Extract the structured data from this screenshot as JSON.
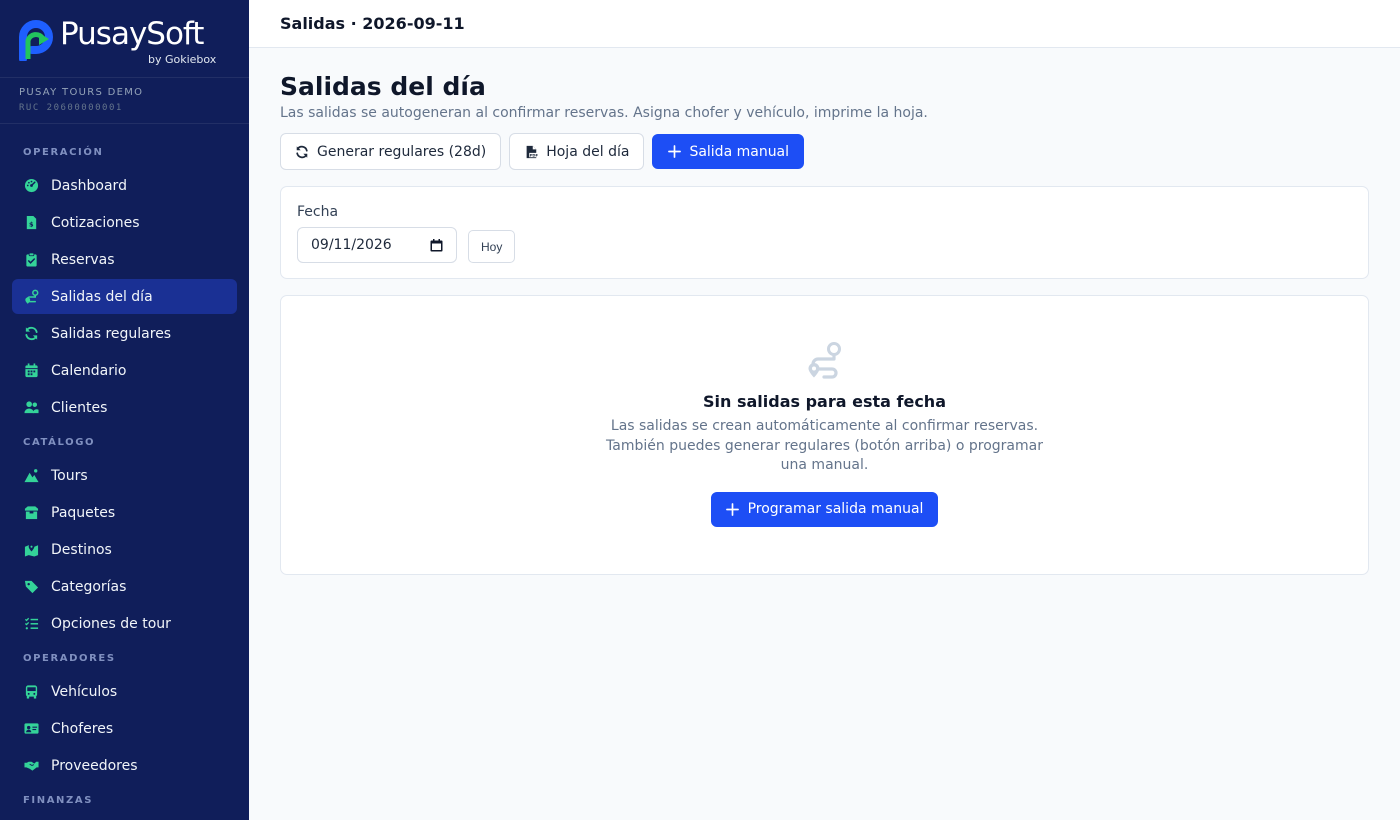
{
  "brand": {
    "name": "PusaySoft",
    "by": "by Gokiebox"
  },
  "company": {
    "name": "PUSAY TOURS DEMO",
    "ruc": "RUC 20600000001"
  },
  "sidebar": {
    "sections": [
      {
        "label": "OPERACIÓN",
        "items": [
          {
            "label": "Dashboard",
            "icon": "gauge-icon"
          },
          {
            "label": "Cotizaciones",
            "icon": "file-invoice-icon"
          },
          {
            "label": "Reservas",
            "icon": "clipboard-check-icon"
          },
          {
            "label": "Salidas del día",
            "icon": "route-icon",
            "active": true
          },
          {
            "label": "Salidas regulares",
            "icon": "refresh-icon"
          },
          {
            "label": "Calendario",
            "icon": "calendar-icon"
          },
          {
            "label": "Clientes",
            "icon": "users-icon"
          }
        ]
      },
      {
        "label": "CATÁLOGO",
        "items": [
          {
            "label": "Tours",
            "icon": "mountain-icon"
          },
          {
            "label": "Paquetes",
            "icon": "box-icon"
          },
          {
            "label": "Destinos",
            "icon": "map-location-icon"
          },
          {
            "label": "Categorías",
            "icon": "tags-icon"
          },
          {
            "label": "Opciones de tour",
            "icon": "list-check-icon"
          }
        ]
      },
      {
        "label": "OPERADORES",
        "items": [
          {
            "label": "Vehículos",
            "icon": "bus-icon"
          },
          {
            "label": "Choferes",
            "icon": "id-card-icon"
          },
          {
            "label": "Proveedores",
            "icon": "handshake-icon"
          }
        ]
      },
      {
        "label": "FINANZAS",
        "items": []
      }
    ]
  },
  "topbar": {
    "title": "Salidas · 2026-09-11"
  },
  "page": {
    "title": "Salidas del día",
    "subtitle": "Las salidas se autogeneran al confirmar reservas. Asigna chofer y vehículo, imprime la hoja."
  },
  "actions": {
    "generate": "Generar regulares (28d)",
    "sheet": "Hoja del día",
    "manual": "Salida manual"
  },
  "filter": {
    "label": "Fecha",
    "date_value": "09/11/2026",
    "today": "Hoy"
  },
  "empty": {
    "title": "Sin salidas para esta fecha",
    "text": "Las salidas se crean automáticamente al confirmar reservas. También puedes generar regulares (botón arriba) o programar una manual.",
    "button": "Programar salida manual"
  },
  "colors": {
    "sidebar_bg": "#101e5a",
    "active_item": "#1a3094",
    "icon_accent": "#34d399",
    "primary": "#1d4ef5"
  }
}
